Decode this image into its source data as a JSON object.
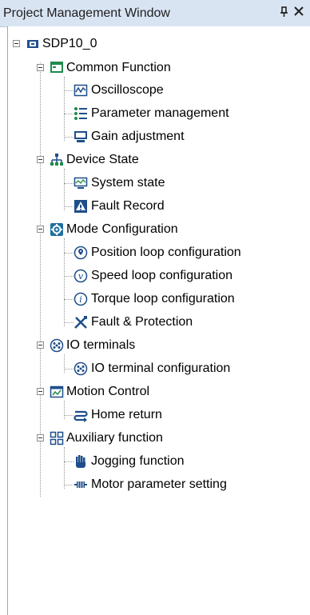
{
  "window": {
    "title": "Project Management Window",
    "pin_glyph": "╠",
    "close_glyph": "✕"
  },
  "tree": {
    "root": {
      "label": "SDP10_0",
      "icon": "device-chip-icon"
    },
    "groups": [
      {
        "label": "Common Function",
        "icon": "function-panel-icon",
        "items": [
          {
            "label": "Oscilloscope",
            "icon": "oscilloscope-icon"
          },
          {
            "label": "Parameter management",
            "icon": "list-icon"
          },
          {
            "label": "Gain adjustment",
            "icon": "gain-monitor-icon"
          }
        ]
      },
      {
        "label": "Device State",
        "icon": "network-hierarchy-icon",
        "items": [
          {
            "label": "System state",
            "icon": "monitor-icon"
          },
          {
            "label": "Fault Record",
            "icon": "fault-record-icon"
          }
        ]
      },
      {
        "label": "Mode Configuration",
        "icon": "gear-icon",
        "items": [
          {
            "label": "Position loop configuration",
            "icon": "position-loop-icon"
          },
          {
            "label": "Speed loop configuration",
            "icon": "speed-loop-icon"
          },
          {
            "label": "Torque loop configuration",
            "icon": "torque-loop-icon"
          },
          {
            "label": "Fault & Protection",
            "icon": "tools-icon"
          }
        ]
      },
      {
        "label": "IO terminals",
        "icon": "io-terminal-icon",
        "items": [
          {
            "label": "IO terminal configuration",
            "icon": "io-terminal-icon"
          }
        ]
      },
      {
        "label": "Motion Control",
        "icon": "motion-control-icon",
        "items": [
          {
            "label": "Home return",
            "icon": "home-return-icon"
          }
        ]
      },
      {
        "label": "Auxiliary function",
        "icon": "grid-icon",
        "items": [
          {
            "label": "Jogging function",
            "icon": "hand-jog-icon"
          },
          {
            "label": "Motor parameter setting",
            "icon": "motor-icon"
          }
        ]
      }
    ]
  },
  "colors": {
    "titlebar": "#d9e4f3",
    "icon_blue": "#1e4e8a",
    "icon_green": "#1f8a4c"
  }
}
